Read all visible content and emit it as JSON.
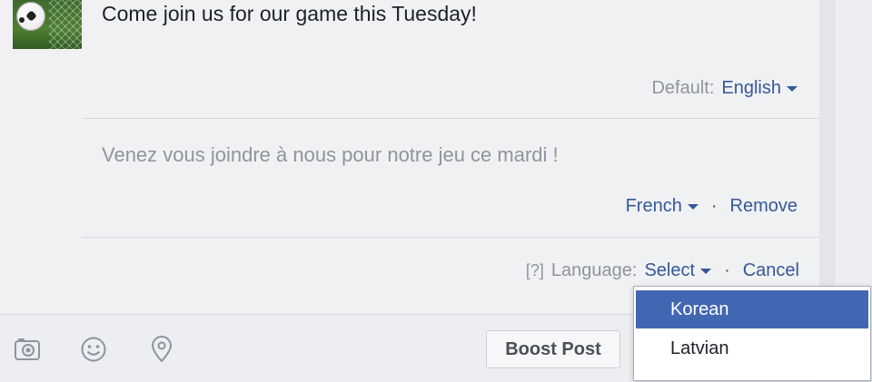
{
  "post": {
    "text": "Come join us for our game this Tuesday!",
    "default_prefix": "Default:",
    "default_language": "English"
  },
  "translation": {
    "text": "Venez vous joindre à nous pour notre jeu ce mardi !",
    "language": "French",
    "separator": "·",
    "remove_label": "Remove"
  },
  "add_language": {
    "help": "[?]",
    "label": "Language:",
    "select_label": "Select",
    "separator": "·",
    "cancel_label": "Cancel"
  },
  "toolbar": {
    "icons": [
      "camera-icon",
      "emoji-icon",
      "location-pin-icon"
    ],
    "boost_label": "Boost Post"
  },
  "dropdown": {
    "options": [
      {
        "label": "Korean",
        "selected": true
      },
      {
        "label": "Latvian",
        "selected": false
      }
    ]
  },
  "colors": {
    "link": "#365899",
    "selected_bg": "#4267b2",
    "muted_text": "#90949c"
  }
}
